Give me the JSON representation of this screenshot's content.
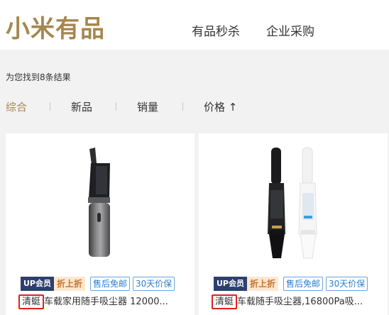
{
  "header": {
    "logo": "小米有品",
    "nav": [
      "有品秒杀",
      "企业采购"
    ]
  },
  "search": {
    "result_text": "为您找到8条结果"
  },
  "sort": {
    "options": [
      "综合",
      "新品",
      "销量",
      "价格"
    ],
    "price_arrow": "↑",
    "active": "综合"
  },
  "products": [
    {
      "vip_tag": "UP会员",
      "discount_tag": "折上折",
      "tags": [
        "售后免邮",
        "30天价保"
      ],
      "brand": "清蜓",
      "title_rest": "车载家用随手吸尘器 12000..."
    },
    {
      "vip_tag": "UP会员",
      "discount_tag": "折上折",
      "tags": [
        "售后免邮",
        "30天价保"
      ],
      "brand": "清蜓",
      "title_rest": "车载随手吸尘器,16800Pa吸..."
    }
  ],
  "colors": {
    "brand_gold": "#a5874f",
    "vip_navy": "#2c3f6e",
    "tag_blue": "#2d7ec8",
    "highlight_red": "#e02020"
  }
}
